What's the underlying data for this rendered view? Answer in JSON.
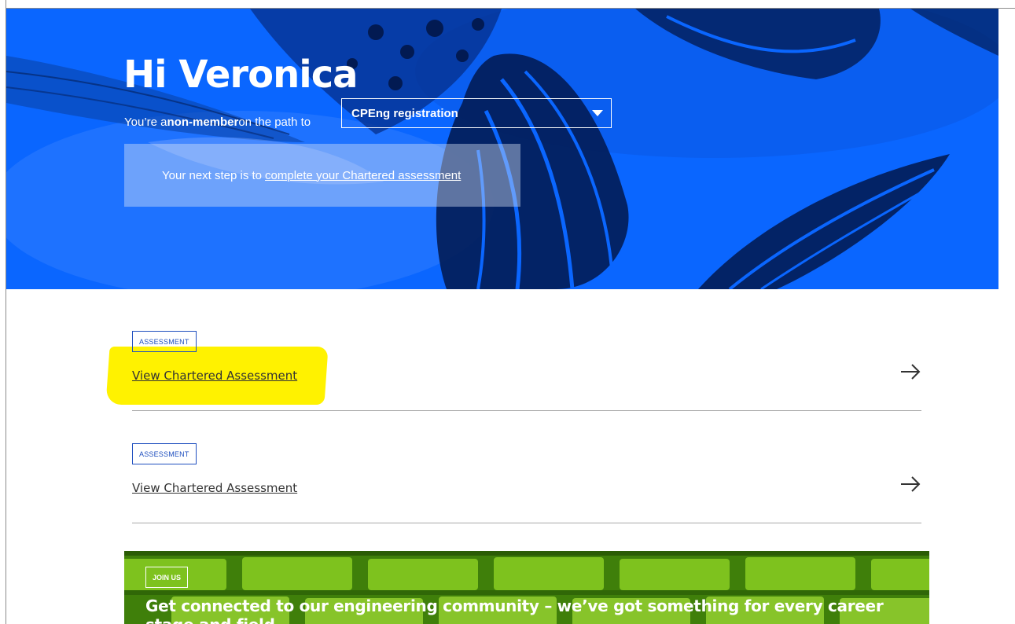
{
  "hero": {
    "greeting": "Hi Veronica",
    "path_prefix": "You’re a ",
    "member_status": "non-member",
    "path_suffix": " on the path to",
    "path_select_value": "CPEng registration",
    "next_step_prefix": "Your next step is to",
    "next_step_link": "complete your Chartered assessment"
  },
  "assessments": [
    {
      "tag": "ASSESSMENT",
      "link": "View Chartered Assessment"
    },
    {
      "tag": "ASSESSMENT",
      "link": "View Chartered Assessment"
    }
  ],
  "banner": {
    "tag": "JOIN US",
    "title": "Get connected to our engineering community – we’ve got something for every career stage and field"
  },
  "colors": {
    "hero_blue": "#0a66ff",
    "highlight_yellow": "#fff200",
    "banner_green": "#4d8f0f",
    "tag_blue": "#1f4fbf"
  }
}
